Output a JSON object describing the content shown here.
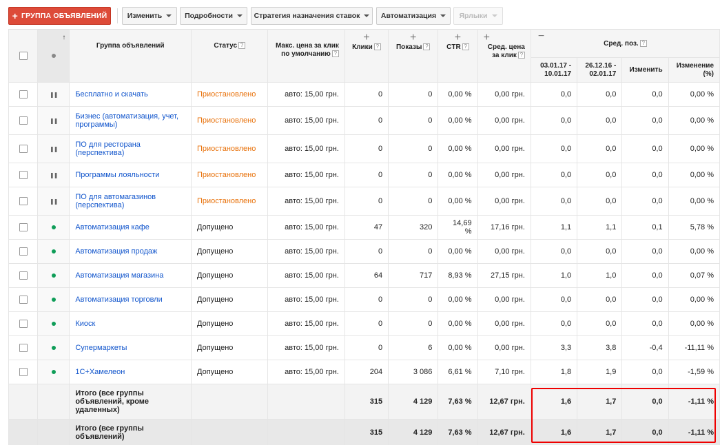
{
  "toolbar": {
    "add_label": "ГРУППА ОБЪЯВЛЕНИЙ",
    "edit_label": "Изменить",
    "details_label": "Подробности",
    "bid_strategy_label": "Стратегия назначения ставок",
    "automation_label": "Автоматизация",
    "labels_label": "Ярлыки"
  },
  "columns": {
    "group": "Группа объявлений",
    "status": "Статус",
    "max_cpc": "Макс. цена за клик по умолчанию",
    "clicks": "Клики",
    "impressions": "Показы",
    "ctr": "CTR",
    "avg_cpc": "Сред. цена за клик",
    "avg_pos": "Сред. поз.",
    "period1": "03.01.17 - 10.01.17",
    "period2": "26.12.16 - 02.01.17",
    "change": "Изменить",
    "change_pct": "Изменение (%)",
    "help": "?"
  },
  "rows": [
    {
      "name": "Бесплатно и скачать",
      "status": "Приостановлено",
      "paused": true,
      "cpc": "авто: 15,00 грн.",
      "clicks": "0",
      "impr": "0",
      "ctr": "0,00 %",
      "avg": "0,00 грн.",
      "p1": "0,0",
      "p2": "0,0",
      "chg": "0,0",
      "pct": "0,00 %"
    },
    {
      "name": "Бизнес (автоматизация, учет, программы)",
      "status": "Приостановлено",
      "paused": true,
      "cpc": "авто: 15,00 грн.",
      "clicks": "0",
      "impr": "0",
      "ctr": "0,00 %",
      "avg": "0,00 грн.",
      "p1": "0,0",
      "p2": "0,0",
      "chg": "0,0",
      "pct": "0,00 %"
    },
    {
      "name": "ПО для ресторана (перспектива)",
      "status": "Приостановлено",
      "paused": true,
      "cpc": "авто: 15,00 грн.",
      "clicks": "0",
      "impr": "0",
      "ctr": "0,00 %",
      "avg": "0,00 грн.",
      "p1": "0,0",
      "p2": "0,0",
      "chg": "0,0",
      "pct": "0,00 %"
    },
    {
      "name": "Программы лояльности",
      "status": "Приостановлено",
      "paused": true,
      "cpc": "авто: 15,00 грн.",
      "clicks": "0",
      "impr": "0",
      "ctr": "0,00 %",
      "avg": "0,00 грн.",
      "p1": "0,0",
      "p2": "0,0",
      "chg": "0,0",
      "pct": "0,00 %"
    },
    {
      "name": "ПО для автомагазинов (перспектива)",
      "status": "Приостановлено",
      "paused": true,
      "cpc": "авто: 15,00 грн.",
      "clicks": "0",
      "impr": "0",
      "ctr": "0,00 %",
      "avg": "0,00 грн.",
      "p1": "0,0",
      "p2": "0,0",
      "chg": "0,0",
      "pct": "0,00 %"
    },
    {
      "name": "Автоматизация кафе",
      "status": "Допущено",
      "paused": false,
      "cpc": "авто: 15,00 грн.",
      "clicks": "47",
      "impr": "320",
      "ctr": "14,69 %",
      "avg": "17,16 грн.",
      "p1": "1,1",
      "p2": "1,1",
      "chg": "0,1",
      "pct": "5,78 %"
    },
    {
      "name": "Автоматизация продаж",
      "status": "Допущено",
      "paused": false,
      "cpc": "авто: 15,00 грн.",
      "clicks": "0",
      "impr": "0",
      "ctr": "0,00 %",
      "avg": "0,00 грн.",
      "p1": "0,0",
      "p2": "0,0",
      "chg": "0,0",
      "pct": "0,00 %"
    },
    {
      "name": "Автоматизация магазина",
      "status": "Допущено",
      "paused": false,
      "cpc": "авто: 15,00 грн.",
      "clicks": "64",
      "impr": "717",
      "ctr": "8,93 %",
      "avg": "27,15 грн.",
      "p1": "1,0",
      "p2": "1,0",
      "chg": "0,0",
      "pct": "0,07 %"
    },
    {
      "name": "Автоматизация торговли",
      "status": "Допущено",
      "paused": false,
      "cpc": "авто: 15,00 грн.",
      "clicks": "0",
      "impr": "0",
      "ctr": "0,00 %",
      "avg": "0,00 грн.",
      "p1": "0,0",
      "p2": "0,0",
      "chg": "0,0",
      "pct": "0,00 %"
    },
    {
      "name": "Киоск",
      "status": "Допущено",
      "paused": false,
      "cpc": "авто: 15,00 грн.",
      "clicks": "0",
      "impr": "0",
      "ctr": "0,00 %",
      "avg": "0,00 грн.",
      "p1": "0,0",
      "p2": "0,0",
      "chg": "0,0",
      "pct": "0,00 %"
    },
    {
      "name": "Супермаркеты",
      "status": "Допущено",
      "paused": false,
      "cpc": "авто: 15,00 грн.",
      "clicks": "0",
      "impr": "6",
      "ctr": "0,00 %",
      "avg": "0,00 грн.",
      "p1": "3,3",
      "p2": "3,8",
      "chg": "-0,4",
      "pct": "-11,11 %"
    },
    {
      "name": "1С+Хамелеон",
      "status": "Допущено",
      "paused": false,
      "cpc": "авто: 15,00 грн.",
      "clicks": "204",
      "impr": "3 086",
      "ctr": "6,61 %",
      "avg": "7,10 грн.",
      "p1": "1,8",
      "p2": "1,9",
      "chg": "0,0",
      "pct": "-1,59 %"
    }
  ],
  "totals": [
    {
      "label": "Итого (все группы объявлений, кроме удаленных)",
      "clicks": "315",
      "impr": "4 129",
      "ctr": "7,63 %",
      "avg": "12,67 грн.",
      "p1": "1,6",
      "p2": "1,7",
      "chg": "0,0",
      "pct": "-1,11 %"
    },
    {
      "label": "Итого (все группы объявлений)",
      "clicks": "315",
      "impr": "4 129",
      "ctr": "7,63 %",
      "avg": "12,67 грн.",
      "p1": "1,6",
      "p2": "1,7",
      "chg": "0,0",
      "pct": "-1,11 %"
    }
  ],
  "colors": {
    "paused": "#e8710a",
    "enabled": "#0f9d58",
    "link": "#1155cc",
    "accent": "#dd4b39",
    "highlight": "#ee0000"
  }
}
